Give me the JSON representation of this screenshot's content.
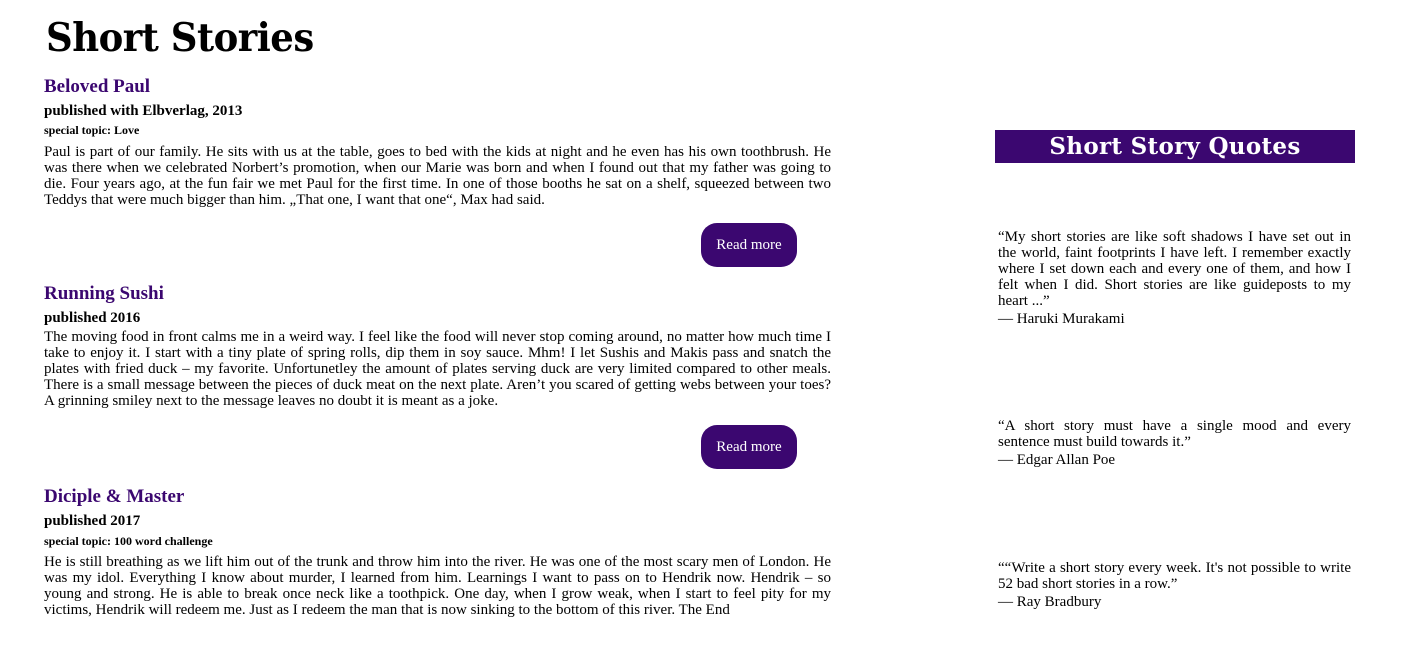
{
  "header": {
    "title": "Short Stories"
  },
  "stories": [
    {
      "title": "Beloved Paul",
      "published": "published with Elbverlag, 2013",
      "topic": "special topic: Love",
      "body": "Paul is part of our family. He sits with us at the table, goes to bed with the kids at night and he even has his own toothbrush. He was there when we celebrated Norbert’s promotion, when our Marie was born and when I found out that my father was going to die. Four years ago, at the fun fair we met Paul for the first time. In one of those booths he sat on a shelf, squeezed between two Teddys that were much bigger than him. „That one, I want that one“, Max had said.",
      "button": "Read more"
    },
    {
      "title": "Running Sushi",
      "published": "published 2016",
      "body": "The moving food in front calms me in a weird way. I feel like the food will never stop coming around, no matter how much time I take to enjoy it. I start with a tiny plate of spring rolls, dip them in soy sauce. Mhm! I let Sushis and Makis pass and snatch the plates with fried duck – my favorite. Unfortunetley the amount of plates serving duck are very limited compared to other meals. There is a small message between the pieces of duck meat on the next plate. Aren’t you scared of getting webs between your toes? A grinning smiley next to the message leaves no doubt it is meant as a joke.",
      "button": "Read more"
    },
    {
      "title": "Diciple & Master",
      "published": "published 2017",
      "topic": "special topic: 100 word challenge",
      "body": "He is still breathing as we lift him out of the trunk and throw him into the river. He was one of the most scary men of London. He was my idol. Everything I know about murder, I learned from him. Learnings I want to pass on to Hendrik now. Hendrik – so young and strong. He is able to break once neck like a toothpick.  One day, when I grow weak, when I start to feel pity for my victims, Hendrik will redeem me. Just as I redeem the man that is now sinking to the bottom of this river. The End"
    }
  ],
  "sidebar": {
    "title": "Short Story Quotes",
    "quotes": [
      {
        "text": "“My short stories are like soft shadows I have set out in the world, faint footprints I have left. I remember exactly where I set down each and every one of them, and how I felt when I did. Short stories are like guideposts to my heart ...”",
        "author": "― Haruki Murakami"
      },
      {
        "text": "“A short story must have a single mood and every sentence must build towards it.”",
        "author": "― Edgar Allan Poe"
      },
      {
        "text": "““Write a short story every week. It's not possible to write 52 bad short stories in a row.”",
        "author": "― Ray Bradbury"
      }
    ]
  },
  "colors": {
    "accent": "#3b0770",
    "button_text": "#ffffff"
  }
}
